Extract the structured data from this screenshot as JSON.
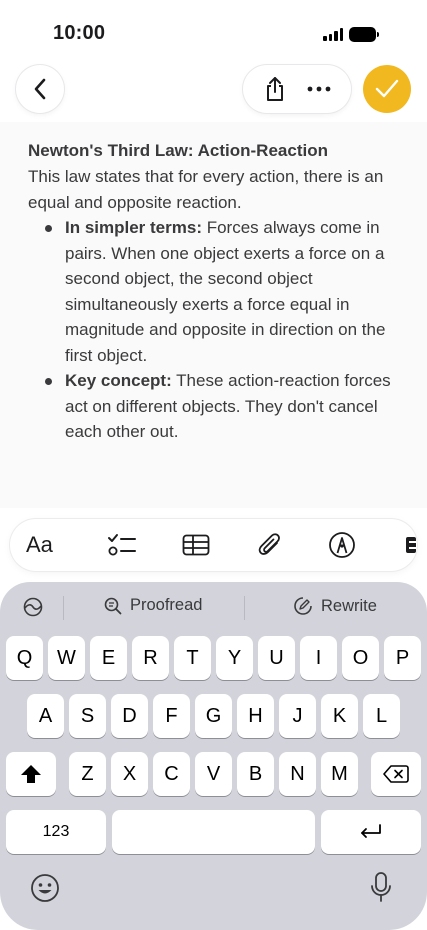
{
  "status": {
    "time": "10:00"
  },
  "colors": {
    "accent": "#f1b81f",
    "keyboard_bg": "#d3d4db"
  },
  "toolbar": {
    "back_icon": "chevron-left-icon",
    "share_icon": "share-icon",
    "more_icon": "ellipsis-icon",
    "done_icon": "checkmark-icon"
  },
  "note": {
    "title": "Newton's Third Law: Action-Reaction",
    "intro": "This law states that for every action, there is an equal and opposite reaction.",
    "bullets": [
      {
        "label": "In simpler terms:",
        "text": " Forces always come in pairs. When one object exerts a force on a second object, the second object simultaneously exerts a force equal in magnitude and opposite in direction on the first object."
      },
      {
        "label": "Key concept:",
        "text": " These action-reaction forces act on different objects. They don't cancel each other out."
      }
    ]
  },
  "format_bar": {
    "text_style": "Aa",
    "items": [
      "checklist-icon",
      "table-icon",
      "paperclip-icon",
      "markup-pen-icon",
      "more-cut-off-icon"
    ]
  },
  "writing_tools": {
    "proofread": "Proofread",
    "rewrite": "Rewrite"
  },
  "keyboard": {
    "row1": [
      "Q",
      "W",
      "E",
      "R",
      "T",
      "Y",
      "U",
      "I",
      "O",
      "P"
    ],
    "row2": [
      "A",
      "S",
      "D",
      "F",
      "G",
      "H",
      "J",
      "K",
      "L"
    ],
    "row3": [
      "Z",
      "X",
      "C",
      "V",
      "B",
      "N",
      "M"
    ],
    "numbers_key": "123"
  }
}
